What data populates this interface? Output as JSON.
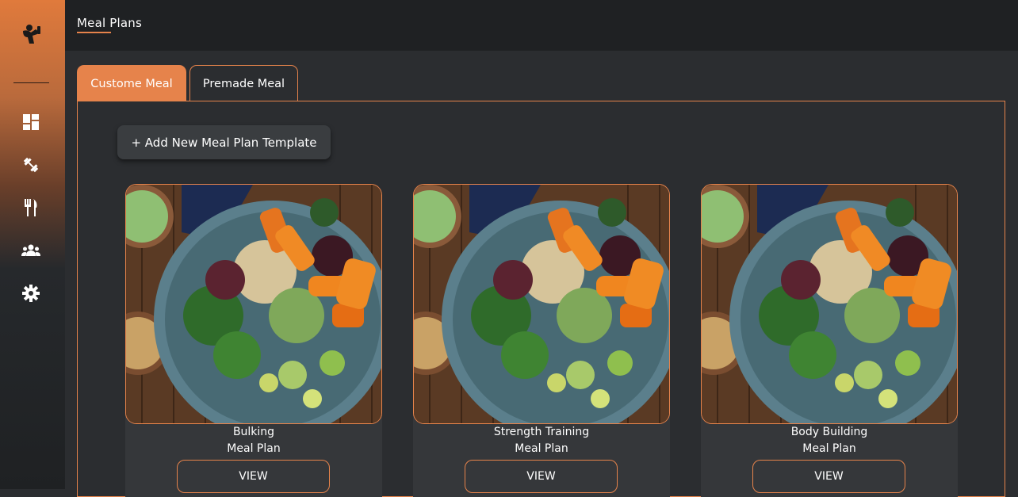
{
  "header": {
    "title": "Meal Plans"
  },
  "sidebar": {
    "icons": [
      "fitness-logo-icon",
      "dashboard-icon",
      "dumbbell-icon",
      "fork-knife-icon",
      "users-icon",
      "gear-icon"
    ]
  },
  "tabs": [
    {
      "label": "Custome Meal",
      "active": true
    },
    {
      "label": "Premade Meal",
      "active": false
    }
  ],
  "add_button": {
    "label": "+ Add New Meal Plan Template"
  },
  "cards": [
    {
      "line1": "Bulking",
      "line2": "Meal Plan",
      "button": "VIEW"
    },
    {
      "line1": "Strength Training",
      "line2": "Meal Plan",
      "button": "VIEW"
    },
    {
      "line1": "Body Building",
      "line2": "Meal Plan",
      "button": "VIEW"
    }
  ],
  "colors": {
    "accent": "#e6834b",
    "background": "#2b2d30",
    "topbar": "#1f2123",
    "card": "#35373a"
  }
}
